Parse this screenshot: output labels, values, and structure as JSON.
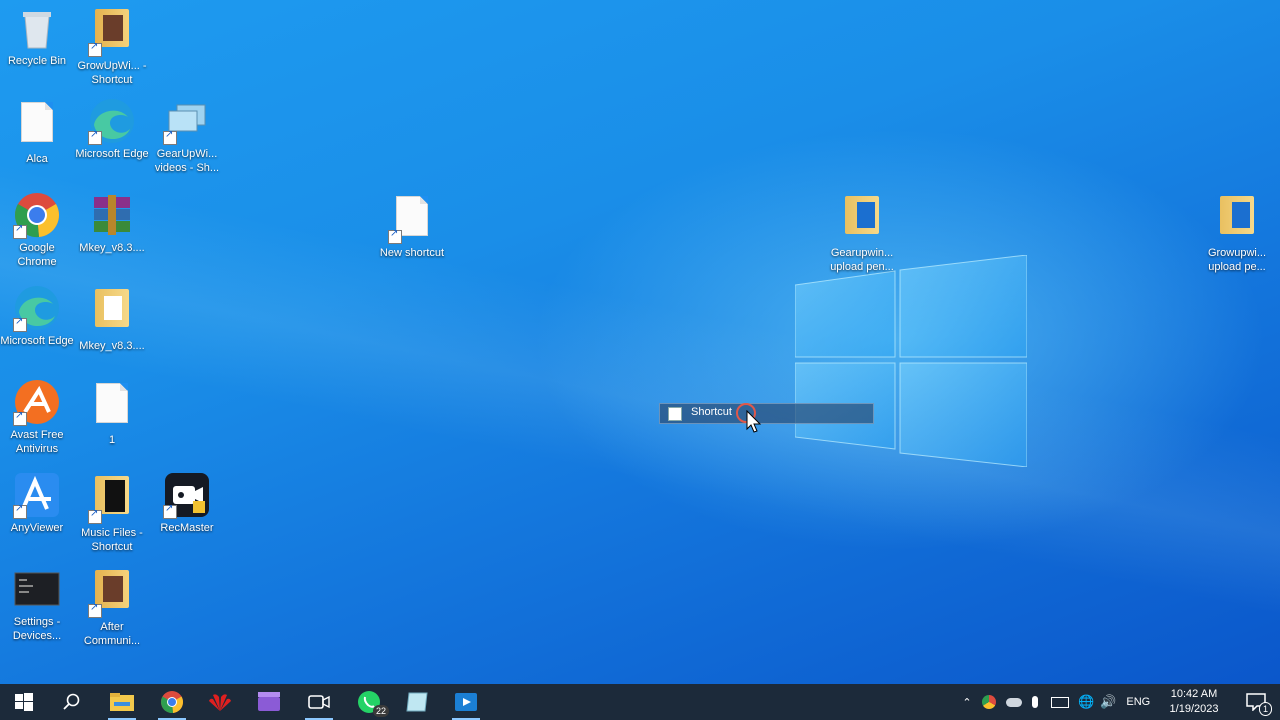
{
  "desktop": {
    "icons": [
      {
        "label": "Recycle Bin"
      },
      {
        "label": "GrowUpWi... - Shortcut"
      },
      {
        "label": "Alca"
      },
      {
        "label": "Microsoft Edge"
      },
      {
        "label": "GearUpWi... videos - Sh..."
      },
      {
        "label": "Google Chrome"
      },
      {
        "label": "Mkey_v8.3...."
      },
      {
        "label": "New shortcut"
      },
      {
        "label": "Gearupwin... upload pen..."
      },
      {
        "label": "Growupwi... upload pe..."
      },
      {
        "label": "Microsoft Edge"
      },
      {
        "label": "Mkey_v8.3...."
      },
      {
        "label": "Avast Free Antivirus"
      },
      {
        "label": "1"
      },
      {
        "label": "AnyViewer"
      },
      {
        "label": "Music Files - Shortcut"
      },
      {
        "label": "RecMaster"
      },
      {
        "label": "Settings - Devices..."
      },
      {
        "label": "After Communi..."
      }
    ]
  },
  "drag": {
    "label": "Shortcut"
  },
  "taskbar": {
    "whatsapp_badge": "22",
    "tray_lang": "ENG",
    "time": "10:42 AM",
    "date": "1/19/2023",
    "notification_count": "1"
  }
}
